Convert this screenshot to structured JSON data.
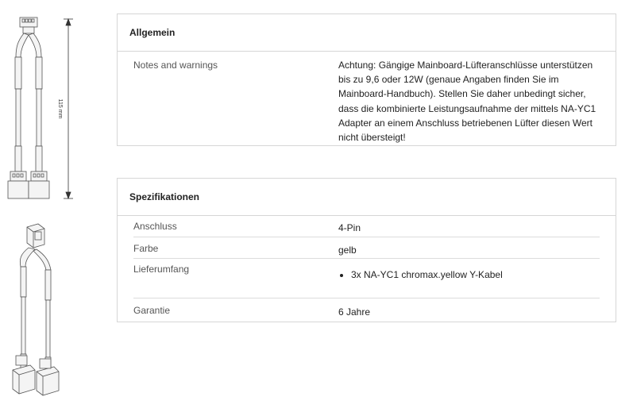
{
  "drawing_top": {
    "dimension_label": "115 mm"
  },
  "allgemein": {
    "title": "Allgemein",
    "rows": [
      {
        "label": "Notes and warnings",
        "value": "Achtung: Gängige Mainboard-Lüfteranschlüsse unterstützen bis zu 9,6 oder 12W (genaue Angaben finden Sie im Mainboard-Handbuch). Stellen Sie daher unbedingt sicher, dass die kombinierte Leistungsaufnahme der mittels NA-YC1 Adapter an einem Anschluss betriebenen Lüfter diesen Wert nicht übersteigt!"
      }
    ]
  },
  "spezifikationen": {
    "title": "Spezifikationen",
    "rows": [
      {
        "label": "Anschluss",
        "value": "4-Pin"
      },
      {
        "label": "Farbe",
        "value": "gelb"
      },
      {
        "label": "Lieferumfang",
        "items": [
          "3x NA-YC1 chromax.yellow Y-Kabel"
        ]
      },
      {
        "label": "Garantie",
        "value": "6 Jahre"
      }
    ]
  }
}
